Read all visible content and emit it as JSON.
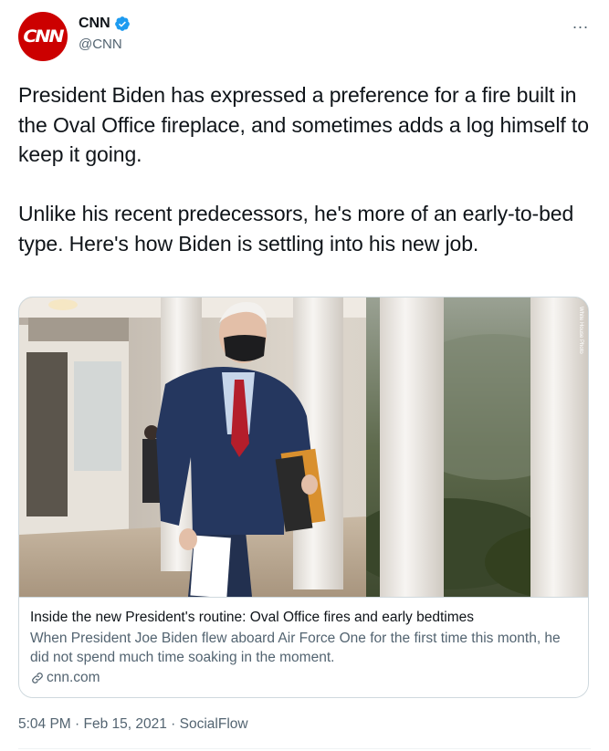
{
  "author": {
    "display_name": "CNN",
    "handle": "@CNN",
    "avatar_text": "CNN",
    "verified": true,
    "avatar_color": "#cc0000"
  },
  "more_icon": "...",
  "tweet": {
    "paragraphs": [
      "President Biden has expressed a preference for a fire built in the Oval Office fireplace, and sometimes adds a log himself to keep it going.",
      "Unlike his recent predecessors, he's more of an early-to-bed type. Here's how Biden is settling into his new job."
    ]
  },
  "card": {
    "image_icon": "photo-biden-colonnade",
    "title": "Inside the new President's routine: Oval Office fires and early bedtimes",
    "description": "When President Joe Biden flew aboard Air Force One for the first time this month, he did not spend much time soaking in the moment.",
    "domain": "cnn.com"
  },
  "meta": {
    "time": "5:04 PM",
    "separator": " · ",
    "date": "Feb 15, 2021",
    "source": "SocialFlow"
  },
  "colors": {
    "text": "#0f1419",
    "secondary": "#536471",
    "verified_blue": "#1d9bf0",
    "border": "#cfd9de"
  }
}
